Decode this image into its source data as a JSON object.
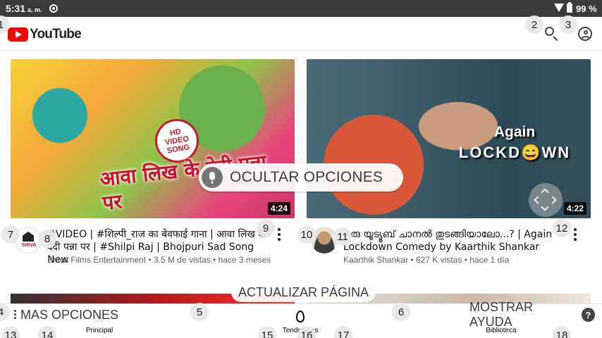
{
  "status_bar": {
    "time": "5:31",
    "ampm": "a. m.",
    "battery": "99 %"
  },
  "header": {
    "logo_text": "YouTube"
  },
  "videos": [
    {
      "thumb_badge_line1": "HD",
      "thumb_badge_line2": "VIDEO",
      "thumb_badge_line3": "SONG",
      "thumb_text": "आवा लिख के देदी पन्ना पर",
      "duration": "4:24",
      "avatar_text": "SHIVA",
      "title": "#VIDEO | #शिल्पी_राज का बेवफाई गाना | आवा लिख के देदी पन्ना पर | #Shilpi Raj | Bhojpuri Sad Song New",
      "channel": "Shiva Films Entertainment",
      "views": "3.5 M de vistas",
      "age": "hace 3 meses"
    },
    {
      "thumb_text_line1": "Again",
      "thumb_text_line2": "LOCKD😄WN",
      "duration": "4:22",
      "title": "ഒരു യൂട്യൂബ് ചാനൽ തുടങ്ങിയാലോ...? | Again Lockdown Comedy by Kaarthik Shankar",
      "channel": "Kaarthik Shankar",
      "views": "627 K vistas",
      "age": "hace 1 día"
    }
  ],
  "bottom_nav": [
    {
      "label": "Principal",
      "icon": "home-icon"
    },
    {
      "label": "Tendencias",
      "icon": "trending-icon"
    },
    {
      "label": "Biblioteca",
      "icon": "library-icon"
    }
  ],
  "overlay": {
    "hide_options": "OCULTAR OPCIONES",
    "refresh_page": "ACTUALIZAR PÁGINA",
    "more_options": "MAS OPCIONES",
    "show_help": "MOSTRAR AYUDA",
    "help_glyph": "?",
    "badges": {
      "b1": "1",
      "b2": "2",
      "b3": "3",
      "b4": "4",
      "b5": "5",
      "b6": "6",
      "b7": "7",
      "b8": "8",
      "b9": "9",
      "b10": "10",
      "b11": "11",
      "b12": "12",
      "b13": "13",
      "b14": "14",
      "b15": "15",
      "b16": "16",
      "b17": "17",
      "b18": "18"
    }
  },
  "meta_sep": "•"
}
